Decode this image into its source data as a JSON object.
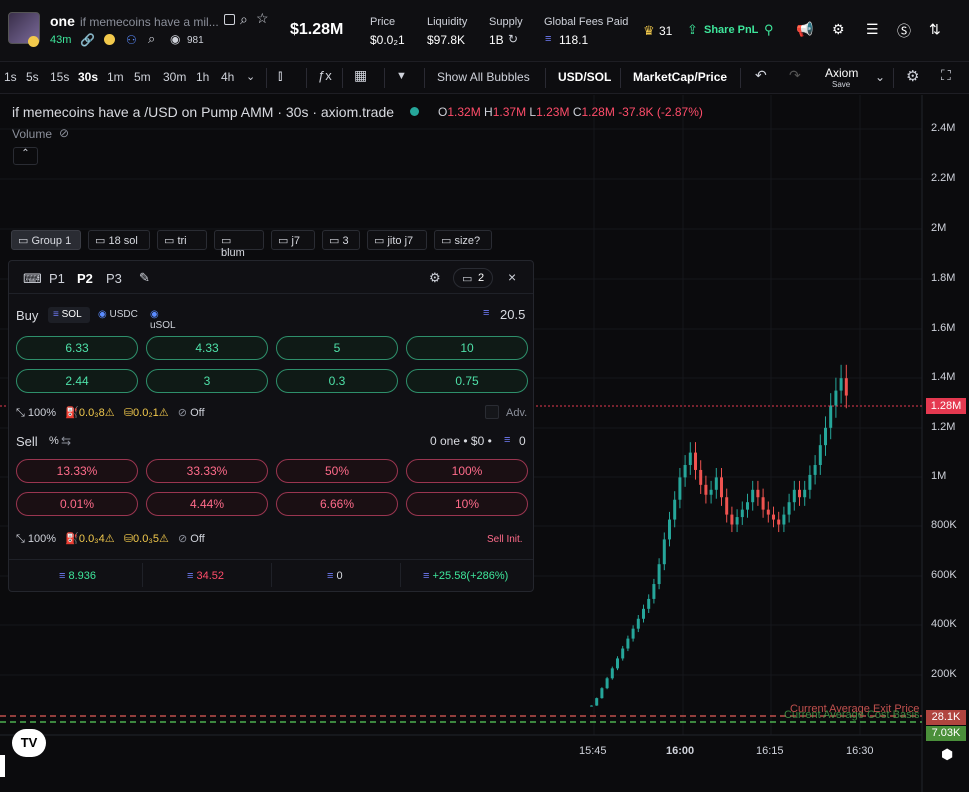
{
  "token": {
    "symbol": "one",
    "name": "if memecoins have a mil...",
    "age": "43m",
    "watchers": "981",
    "market_cap": "$1.28M"
  },
  "stats": {
    "price_label": "Price",
    "price_value": "$0.0₂1",
    "liquidity_label": "Liquidity",
    "liquidity_value": "$97.8K",
    "supply_label": "Supply",
    "supply_value": "1B",
    "fees_label": "Global Fees Paid",
    "fees_value": "118.1"
  },
  "header_actions": {
    "crown_count": "31",
    "share_label": "Share PnL"
  },
  "timeframes": [
    "1s",
    "5s",
    "15s",
    "30s",
    "1m",
    "5m",
    "30m",
    "1h",
    "4h"
  ],
  "active_timeframe": "30s",
  "toolbar": {
    "fx": "ƒx",
    "bubbles": "Show All Bubbles",
    "pair": "USD/SOL",
    "mode": "MarketCap/Price",
    "brand": "Axiom",
    "save": "Save"
  },
  "chart_header": {
    "title": "if memecoins have a /USD on Pump AMM · 30s · axiom.trade",
    "o_label": "O",
    "o_value": "1.32M",
    "h_label": "H",
    "h_value": "1.37M",
    "l_label": "L",
    "l_value": "1.23M",
    "c_label": "C",
    "c_value": "1.28M",
    "change": "-37.8K (-2.87%)",
    "volume_label": "Volume"
  },
  "presets": [
    "Group 1",
    "18 sol",
    "tri",
    "blum",
    "j7",
    "3",
    "jito j7",
    "size?"
  ],
  "panel": {
    "tabs": [
      "P1",
      "P2",
      "P3"
    ],
    "active_tab": "P2",
    "wallet_count": "2",
    "buy_label": "Buy",
    "currencies": [
      "SOL",
      "USDC",
      "uSOL"
    ],
    "buy_balance": "20.5",
    "buy_amounts": [
      "6.33",
      "4.33",
      "5",
      "10",
      "2.44",
      "3",
      "0.3",
      "0.75"
    ],
    "buy_settings": {
      "slippage": "100%",
      "priority": "0.0₃8",
      "bribe": "0.0₂1",
      "mev": "Off",
      "adv": "Adv."
    },
    "sell_label": "Sell",
    "sell_unit": "%",
    "sell_holdings": "0 one • $0 •",
    "sell_sol": "0",
    "sell_amounts": [
      "13.33%",
      "33.33%",
      "50%",
      "100%",
      "0.01%",
      "4.44%",
      "6.66%",
      "10%"
    ],
    "sell_settings": {
      "slippage": "100%",
      "priority": "0.0₃4",
      "bribe": "0.0₃5",
      "mev": "Off",
      "init": "Sell Init."
    },
    "footer": {
      "bought": "8.936",
      "sold": "34.52",
      "holding": "0",
      "pnl": "+25.58(+286%)"
    }
  },
  "price_axis": [
    "2.4M",
    "2.2M",
    "2M",
    "1.8M",
    "1.6M",
    "1.4M",
    "1.2M",
    "1M",
    "800K",
    "600K",
    "400K",
    "200K"
  ],
  "time_axis": [
    "15:45",
    "16:00",
    "16:15",
    "16:30"
  ],
  "price_tags": {
    "last": "1.28M",
    "exit": "28.1K",
    "cost": "7.03K"
  },
  "line_labels": {
    "exit": "Current Average Exit Price",
    "cost": "Current Average Cost Basis"
  },
  "colors": {
    "up": "#26a69a",
    "down": "#ef5350",
    "buy": "#3ee69b",
    "sell": "#ff4d6a",
    "accent": "#f2c94c",
    "exit": "#c0504d",
    "cost": "#4caf50"
  },
  "chart_data": {
    "type": "candlestick",
    "y_unit": "market cap (USD)",
    "ylim": [
      0,
      2500000
    ],
    "x_ticks": [
      "15:45",
      "16:00",
      "16:15",
      "16:30"
    ],
    "last_close": 1280000,
    "series_close": [
      30000,
      60000,
      100000,
      140000,
      180000,
      220000,
      260000,
      300000,
      340000,
      380000,
      420000,
      460000,
      520000,
      600000,
      700000,
      780000,
      860000,
      950000,
      1000000,
      1050000,
      980000,
      920000,
      880000,
      900000,
      950000,
      870000,
      800000,
      760000,
      790000,
      820000,
      850000,
      900000,
      870000,
      820000,
      800000,
      780000,
      760000,
      800000,
      850000,
      900000,
      870000,
      900000,
      960000,
      1000000,
      1080000,
      1150000,
      1240000,
      1300000,
      1350000,
      1280000
    ]
  }
}
